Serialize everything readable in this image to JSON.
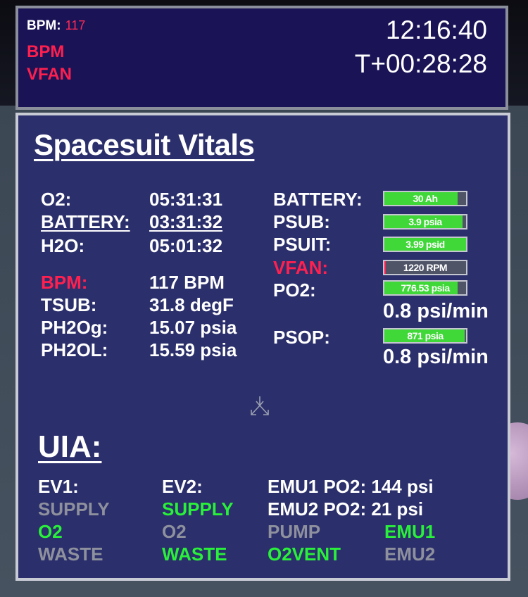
{
  "header": {
    "bpm_label": "BPM:",
    "bpm_value": "117",
    "alerts": [
      "BPM",
      "VFAN"
    ],
    "clock": "12:16:40",
    "mission_elapsed": "T+00:28:28"
  },
  "vitals": {
    "title": "Spacesuit Vitals",
    "timers": [
      {
        "label": "O2:",
        "value": "05:31:31"
      },
      {
        "label": "BATTERY:",
        "value": "03:31:32"
      },
      {
        "label": "H2O:",
        "value": "05:01:32"
      }
    ],
    "readings": [
      {
        "label": "BPM:",
        "value": "117 BPM"
      },
      {
        "label": "TSUB:",
        "value": "31.8 degF"
      },
      {
        "label": "PH2Og:",
        "value": "15.07 psia"
      },
      {
        "label": "PH2OL:",
        "value": "15.59 psia"
      }
    ],
    "gauges": [
      {
        "label": "BATTERY:",
        "text": "30 Ah",
        "level": 0.9,
        "status": "ok"
      },
      {
        "label": "PSUB:",
        "text": "3.9 psia",
        "level": 0.96,
        "status": "ok"
      },
      {
        "label": "PSUIT:",
        "text": "3.99 psid",
        "level": 1.0,
        "status": "ok"
      },
      {
        "label": "VFAN:",
        "text": "1220 RPM",
        "level": 0.02,
        "status": "alert"
      },
      {
        "label": "PO2:",
        "text": "776.53 psia",
        "level": 0.9,
        "status": "ok"
      },
      {
        "label": "PSOP:",
        "text": "871 psia",
        "level": 0.98,
        "status": "ok"
      }
    ],
    "po2_rate": "0.8 psi/min",
    "psop_rate": "0.8 psi/min"
  },
  "uia": {
    "title": "UIA:",
    "ev1": {
      "label": "EV1:",
      "supply": "SUPPLY",
      "o2": "O2",
      "waste": "WASTE"
    },
    "ev2": {
      "label": "EV2:",
      "supply": "SUPPLY",
      "o2": "O2",
      "waste": "WASTE"
    },
    "emu1_po2": "EMU1 PO2: 144 psi",
    "emu2_po2": "EMU2 PO2: 21 psi",
    "pump": "PUMP",
    "o2vent": "O2VENT",
    "emu1": "EMU1",
    "emu2": "EMU2"
  },
  "colors": {
    "alert": "#ff1f4f",
    "active": "#29f03a",
    "inactive": "#8e919d",
    "panel": "#2b2f6b",
    "header": "#1a1456"
  }
}
